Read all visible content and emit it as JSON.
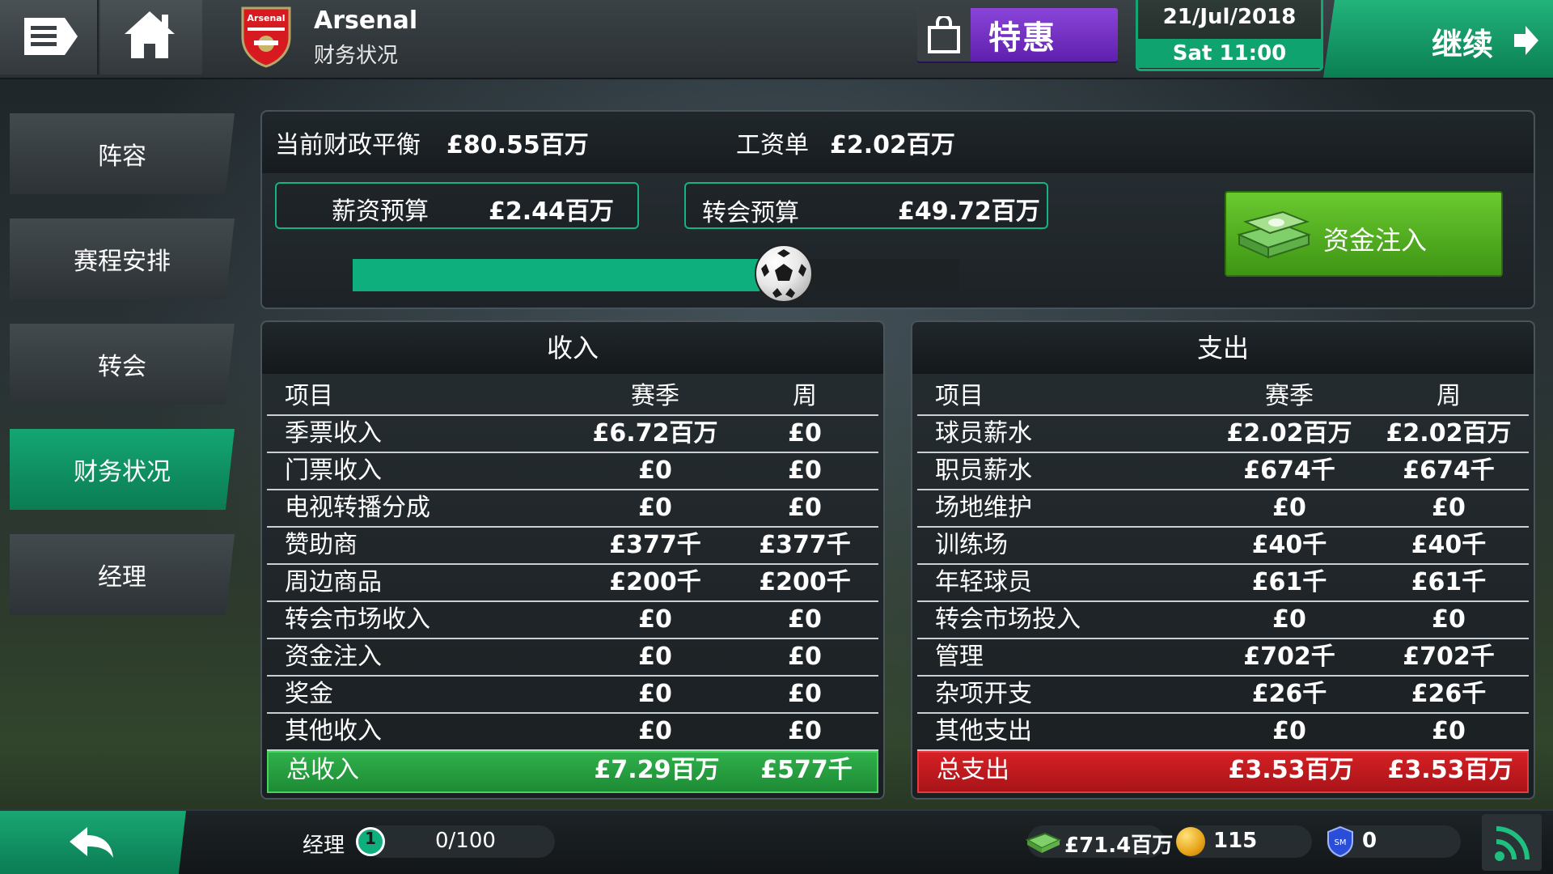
{
  "header": {
    "club_name": "Arsenal",
    "crest_text": "Arsenal",
    "page_subtitle": "财务状况",
    "offer_label": "特惠",
    "date": "21/Jul/2018",
    "day_time": "Sat 11:00",
    "continue_label": "继续",
    "colors": {
      "offer": "#7a35c8",
      "accent_green": "#0fa36f"
    }
  },
  "nav": {
    "items": [
      {
        "label": "阵容",
        "active": false
      },
      {
        "label": "赛程安排",
        "active": false
      },
      {
        "label": "转会",
        "active": false
      },
      {
        "label": "财务状况",
        "active": true
      },
      {
        "label": "经理",
        "active": false
      }
    ]
  },
  "summary": {
    "balance_label": "当前财政平衡",
    "balance_value": "£80.55百万",
    "payroll_label": "工资单",
    "payroll_value": "£2.02百万",
    "wage_budget_label": "薪资预算",
    "wage_budget_value": "£2.44百万",
    "transfer_budget_label": "转会预算",
    "transfer_budget_value": "£49.72百万",
    "budget_slider_fraction": 0.71,
    "inject_label": "资金注入"
  },
  "income": {
    "title": "收入",
    "columns": [
      "项目",
      "赛季",
      "周"
    ],
    "rows": [
      [
        "季票收入",
        "£6.72百万",
        "£0"
      ],
      [
        "门票收入",
        "£0",
        "£0"
      ],
      [
        "电视转播分成",
        "£0",
        "£0"
      ],
      [
        "赞助商",
        "£377千",
        "£377千"
      ],
      [
        "周边商品",
        "£200千",
        "£200千"
      ],
      [
        "转会市场收入",
        "£0",
        "£0"
      ],
      [
        "资金注入",
        "£0",
        "£0"
      ],
      [
        "奖金",
        "£0",
        "£0"
      ],
      [
        "其他收入",
        "£0",
        "£0"
      ]
    ],
    "total": [
      "总收入",
      "£7.29百万",
      "£577千"
    ]
  },
  "expense": {
    "title": "支出",
    "columns": [
      "项目",
      "赛季",
      "周"
    ],
    "rows": [
      [
        "球员薪水",
        "£2.02百万",
        "£2.02百万"
      ],
      [
        "职员薪水",
        "£674千",
        "£674千"
      ],
      [
        "场地维护",
        "£0",
        "£0"
      ],
      [
        "训练场",
        "£40千",
        "£40千"
      ],
      [
        "年轻球员",
        "£61千",
        "£61千"
      ],
      [
        "转会市场投入",
        "£0",
        "£0"
      ],
      [
        "管理",
        "£702千",
        "£702千"
      ],
      [
        "杂项开支",
        "£26千",
        "£26千"
      ],
      [
        "其他支出",
        "£0",
        "£0"
      ]
    ],
    "total": [
      "总支出",
      "£3.53百万",
      "£3.53百万"
    ]
  },
  "footer": {
    "manager_label": "经理",
    "manager_level": "1",
    "xp": "0/100",
    "xp_fraction": 0,
    "cash": "£71.4百万",
    "coins": "115",
    "tokens": "0",
    "token_text": "SM"
  }
}
